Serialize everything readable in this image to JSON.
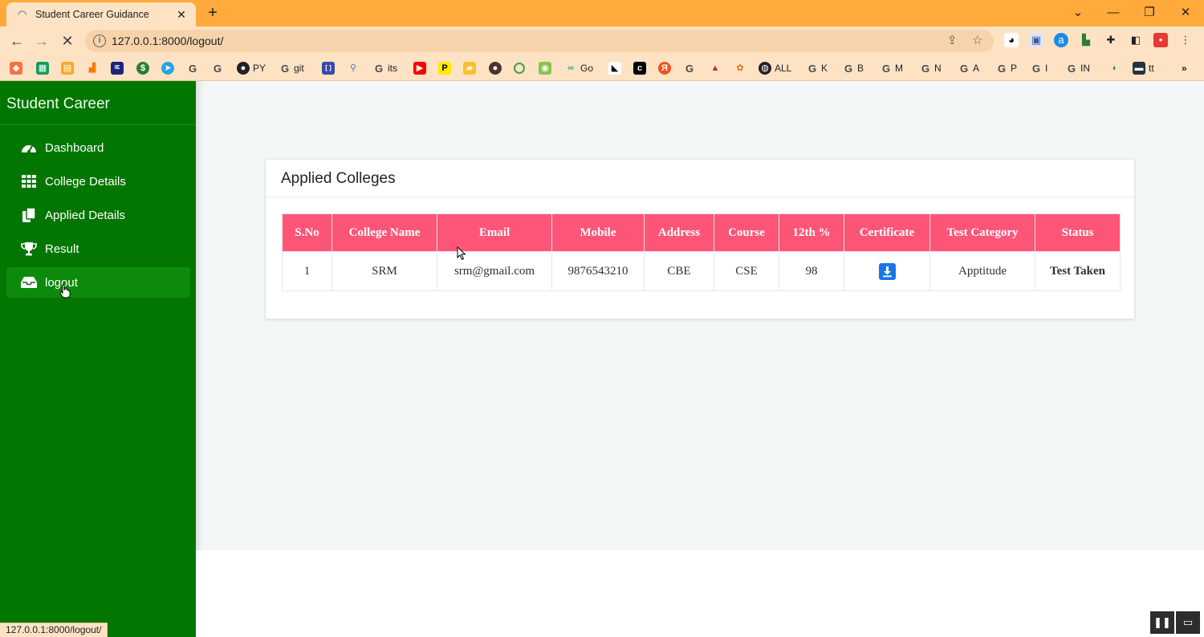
{
  "browser": {
    "tab_title": "Student Career Guidance",
    "tab_close": "✕",
    "new_tab": "+",
    "url": "127.0.0.1:8000/logout/",
    "status_url": "127.0.0.1:8000/logout/",
    "window_controls": {
      "menu": "⌄",
      "minimize": "—",
      "restore": "❐",
      "close": "✕"
    },
    "bookmarks": [
      {
        "label": "PY",
        "icon": "github-icon"
      },
      {
        "label": "git",
        "icon": "google-icon"
      },
      {
        "label": "its",
        "icon": "google-icon"
      },
      {
        "label": "Go",
        "icon": "loop-icon"
      },
      {
        "label": "ALL",
        "icon": "globe-icon"
      },
      {
        "label": "K",
        "icon": "google-icon"
      },
      {
        "label": "B",
        "icon": "google-icon"
      },
      {
        "label": "M",
        "icon": "google-icon"
      },
      {
        "label": "N",
        "icon": "google-icon"
      },
      {
        "label": "A",
        "icon": "google-icon"
      },
      {
        "label": "P",
        "icon": "google-icon"
      },
      {
        "label": "I",
        "icon": "google-icon"
      },
      {
        "label": "IN",
        "icon": "google-icon"
      },
      {
        "label": "tt",
        "icon": "bus-icon"
      }
    ],
    "bookmarks_overflow": "»"
  },
  "sidebar": {
    "brand": "Student Career",
    "items": [
      {
        "label": "Dashboard",
        "icon": "dashboard-gauge-icon"
      },
      {
        "label": "College Details",
        "icon": "grid-icon"
      },
      {
        "label": "Applied Details",
        "icon": "copy-documents-icon"
      },
      {
        "label": "Result",
        "icon": "trophy-icon"
      },
      {
        "label": "logout",
        "icon": "inbox-tray-icon",
        "active": true
      }
    ]
  },
  "main": {
    "card_title": "Applied Colleges",
    "table": {
      "headers": [
        "S.No",
        "College Name",
        "Email",
        "Mobile",
        "Address",
        "Course",
        "12th %",
        "Certificate",
        "Test Category",
        "Status"
      ],
      "rows": [
        {
          "sno": "1",
          "college_name": "SRM",
          "email": "srm@gmail.com",
          "mobile": "9876543210",
          "address": "CBE",
          "course": "CSE",
          "twelfth": "98",
          "certificate_icon": "download-icon",
          "test_category": "Apptitude",
          "status": "Test Taken"
        }
      ]
    }
  },
  "colors": {
    "sidebar_bg": "#027600",
    "table_header_bg": "#fd5578",
    "download_button": "#1877e8",
    "status_text": "#0b7a0b",
    "browser_frame": "#ffaa3a"
  }
}
